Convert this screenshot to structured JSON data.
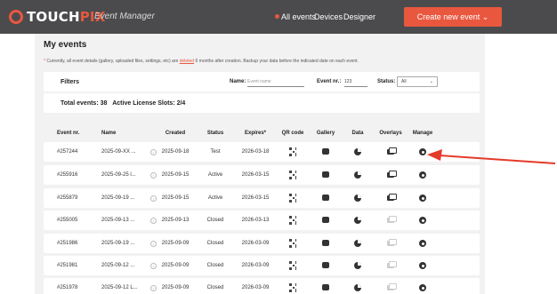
{
  "header": {
    "brand_a": "TOUCH",
    "brand_b": "PIX",
    "subtitle": "Event Manager",
    "nav": [
      "All events",
      "Devices",
      "Designer"
    ],
    "create_button": "Create new event ⌄"
  },
  "page": {
    "title": "My events",
    "notice_star": "*",
    "notice_text": " Currently, all event details (gallery, uploaded files, settings, etc) are ",
    "notice_link": "deleted",
    "notice_tail": " 6 months after creation. Backup your data before the indicated date on each event."
  },
  "filters": {
    "label": "Filters",
    "name_label": "Name:",
    "name_placeholder": "Event name",
    "nr_label": "Event nr.:",
    "nr_value": "123",
    "status_label": "Status:",
    "status_value": "All"
  },
  "totals": {
    "events": "Total events: 38",
    "slots": "Active License Slots: 2/4"
  },
  "table": {
    "headers": [
      "Event nr.",
      "Name",
      "Created",
      "Status",
      "Expires*",
      "QR code",
      "Gallery",
      "Data",
      "Overlays",
      "Manage"
    ],
    "rows": [
      {
        "nr": "#257244",
        "name": "2025-09-XX ...",
        "created": "2025-09-18",
        "status": "Test",
        "expires": "2026-03-18",
        "overlay": true
      },
      {
        "nr": "#255916",
        "name": "2025-09-25 l...",
        "created": "2025-09-15",
        "status": "Active",
        "expires": "2026-03-15",
        "overlay": true
      },
      {
        "nr": "#255879",
        "name": "2025-09-19 ...",
        "created": "2025-09-15",
        "status": "Active",
        "expires": "2026-03-15",
        "overlay": true
      },
      {
        "nr": "#255005",
        "name": "2025-09-13 ...",
        "created": "2025-09-13",
        "status": "Closed",
        "expires": "2026-03-13",
        "overlay": false
      },
      {
        "nr": "#251986",
        "name": "2025-09-19 ...",
        "created": "2025-09-09",
        "status": "Closed",
        "expires": "2026-03-09",
        "overlay": false
      },
      {
        "nr": "#251981",
        "name": "2025-09-12 ...",
        "created": "2025-09-09",
        "status": "Closed",
        "expires": "2026-03-09",
        "overlay": false
      },
      {
        "nr": "#251978",
        "name": "2025-09-12 L...",
        "created": "2025-09-09",
        "status": "Closed",
        "expires": "2026-03-09",
        "overlay": false
      }
    ]
  },
  "colors": {
    "accent": "#e9573f",
    "topbar": "#4b4b4d",
    "page_bg": "#f2f2f2",
    "annotation_arrow": "#e53a2a"
  },
  "icons": {
    "qr": "qr-code-icon",
    "gallery": "gallery-icon",
    "data": "data-icon",
    "overlays": "overlays-icon",
    "manage": "gear-icon",
    "info": "info-icon"
  }
}
